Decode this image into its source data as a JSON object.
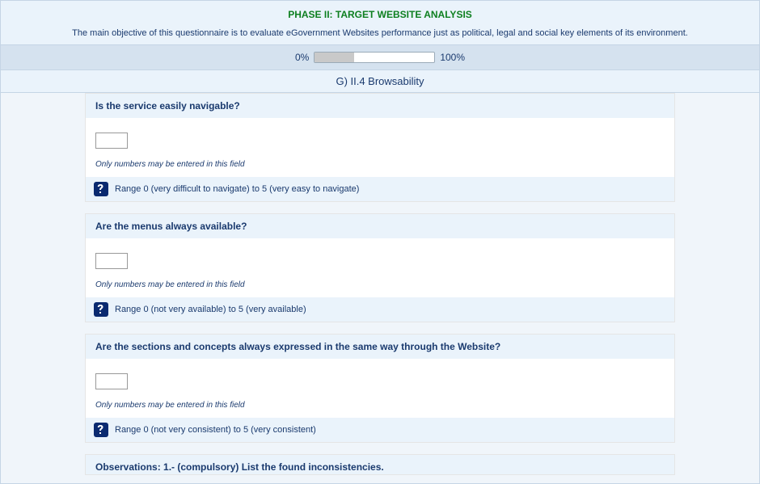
{
  "header": {
    "phase_title": "PHASE II: TARGET WEBSITE ANALYSIS",
    "objective": "The main objective of this questionnaire is to evaluate eGovernment Websites performance just as political, legal and social key elements of its environment."
  },
  "progress": {
    "left_label": "0%",
    "right_label": "100%",
    "percent": 33
  },
  "section": {
    "title": "G) II.4 Browsability"
  },
  "questions": [
    {
      "title": "Is the service easily navigable?",
      "hint": "Only numbers may be entered in this field",
      "range": "Range 0 (very difficult to navigate) to 5 (very easy to navigate)"
    },
    {
      "title": "Are the menus always available?",
      "hint": "Only numbers may be entered in this field",
      "range": "Range 0 (not very available) to 5 (very available)"
    },
    {
      "title": "Are the sections and concepts always expressed in the same way through the Website?",
      "hint": "Only numbers may be entered in this field",
      "range": "Range 0 (not very consistent) to 5 (very consistent)"
    }
  ],
  "observations": {
    "title": "Observations: 1.- (compulsory) List the found inconsistencies."
  }
}
